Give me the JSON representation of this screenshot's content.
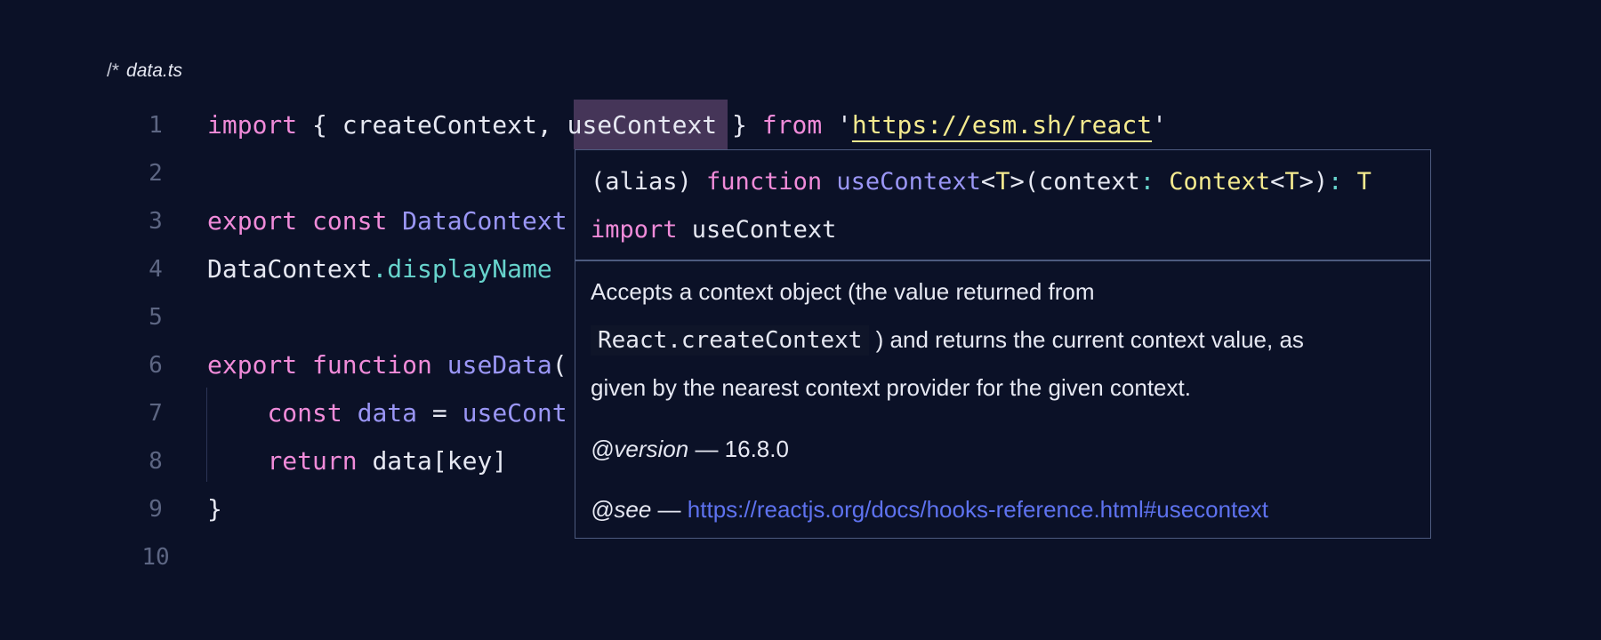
{
  "file": {
    "comment_marker": "/*",
    "name": "data.ts"
  },
  "code_lines": [
    {
      "number": "1",
      "tokens": [
        [
          "import",
          "kw"
        ],
        [
          " { createContext, ",
          "pl"
        ],
        [
          "useContext",
          "pl"
        ],
        [
          " } ",
          "pl"
        ],
        [
          "from",
          "kw"
        ],
        [
          " '",
          "pl"
        ],
        [
          "https://esm.sh/react",
          "strlink"
        ],
        [
          "'",
          "pl"
        ]
      ]
    },
    {
      "number": "2",
      "tokens": []
    },
    {
      "number": "3",
      "tokens": [
        [
          "export",
          "kw"
        ],
        [
          " ",
          "pl"
        ],
        [
          "const",
          "kw"
        ],
        [
          " ",
          "pl"
        ],
        [
          "DataContext",
          "fnc"
        ]
      ]
    },
    {
      "number": "4",
      "tokens": [
        [
          "DataContext",
          "pl"
        ],
        [
          ".",
          "prop"
        ],
        [
          "displayName",
          "prop"
        ]
      ]
    },
    {
      "number": "5",
      "tokens": []
    },
    {
      "number": "6",
      "tokens": [
        [
          "export",
          "kw"
        ],
        [
          " ",
          "pl"
        ],
        [
          "function",
          "kw"
        ],
        [
          " ",
          "pl"
        ],
        [
          "useData",
          "fnc"
        ],
        [
          "(",
          "pl"
        ]
      ]
    },
    {
      "number": "7",
      "tokens": [
        [
          "    ",
          "pl"
        ],
        [
          "const",
          "kw"
        ],
        [
          " ",
          "pl"
        ],
        [
          "data",
          "fnc"
        ],
        [
          " = ",
          "pl"
        ],
        [
          "useCont",
          "fnc"
        ]
      ]
    },
    {
      "number": "8",
      "tokens": [
        [
          "    ",
          "pl"
        ],
        [
          "return",
          "kw"
        ],
        [
          " data[key]",
          "pl"
        ]
      ]
    },
    {
      "number": "9",
      "tokens": [
        [
          "}",
          "pl"
        ]
      ]
    },
    {
      "number": "10",
      "tokens": []
    }
  ],
  "hover": {
    "signature": [
      [
        "(alias) ",
        "pl"
      ],
      [
        "function",
        "kw"
      ],
      [
        " ",
        "pl"
      ],
      [
        "useContext",
        "fnc"
      ],
      [
        "<",
        "pl"
      ],
      [
        "T",
        "str"
      ],
      [
        ">(context",
        "pl"
      ],
      [
        ": ",
        "prop"
      ],
      [
        "Context",
        "str"
      ],
      [
        "<",
        "pl"
      ],
      [
        "T",
        "str"
      ],
      [
        ">)",
        "pl"
      ],
      [
        ": ",
        "prop"
      ],
      [
        "T",
        "str"
      ]
    ],
    "import_line": [
      [
        "import",
        "kw"
      ],
      [
        " useContext",
        "pl"
      ]
    ],
    "description_line1": "Accepts a context object (the value returned from",
    "description_code": "React.createContext",
    "description_line2_rest": ") and returns the current context value, as",
    "description_line3": "given by the nearest context provider for the given context.",
    "version_tag": "@version",
    "version_value": " — 16.8.0",
    "see_tag": "@see",
    "see_sep": " — ",
    "see_link": "https://reactjs.org/docs/hooks-reference.html#usecontext"
  },
  "colors": {
    "background": "#0b1127",
    "keyword": "#f08bd9",
    "function": "#9a96f5",
    "property": "#67d3cc",
    "string": "#f4ea8f",
    "link": "#5e72ef",
    "highlight": "#453558"
  }
}
